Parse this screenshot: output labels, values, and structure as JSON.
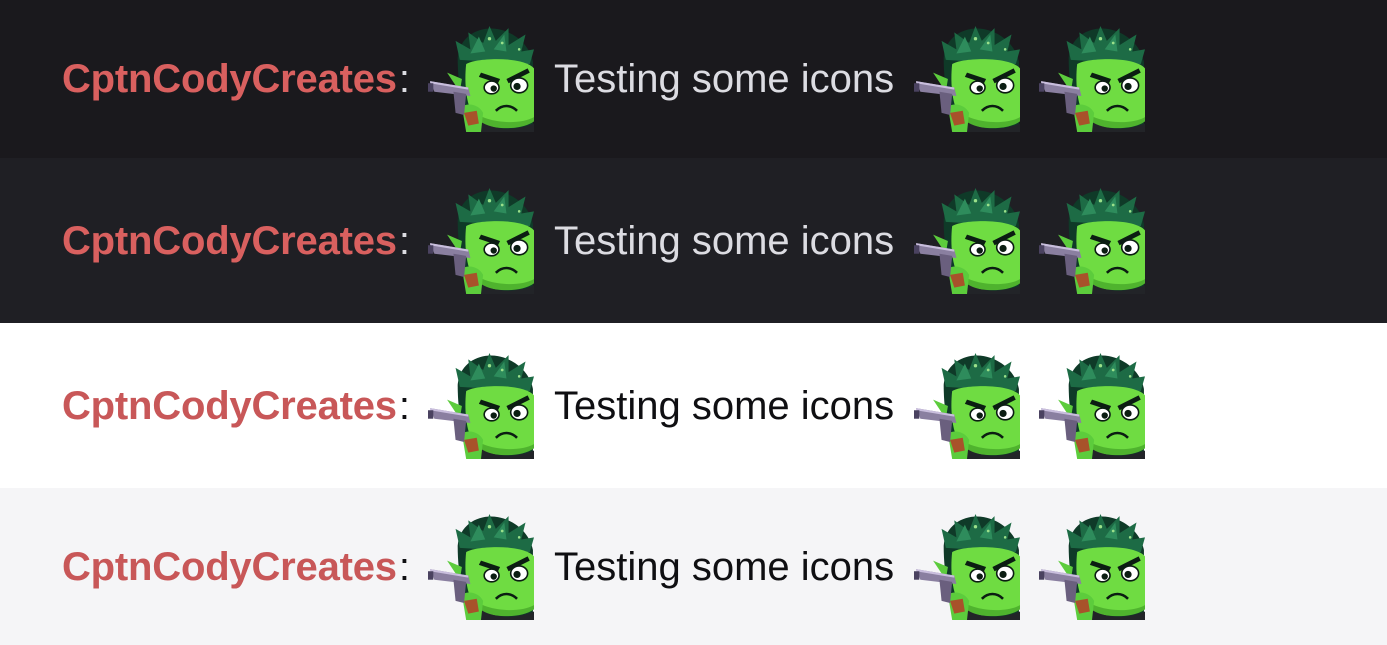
{
  "chat": {
    "messages": [
      {
        "theme": "dark",
        "background": "#1a191d",
        "username": "CptnCodyCreates",
        "username_color": "#d9605f",
        "separator": ":",
        "text": "Testing some icons",
        "text_color": "#dcdce2",
        "emotes": [
          "goblin-gunner-emote",
          "goblin-gunner-emote",
          "goblin-gunner-emote"
        ]
      },
      {
        "theme": "dark-alt",
        "background": "#1f1f24",
        "username": "CptnCodyCreates",
        "username_color": "#d9605f",
        "separator": ":",
        "text": "Testing some icons",
        "text_color": "#dcdce2",
        "emotes": [
          "goblin-gunner-emote",
          "goblin-gunner-emote",
          "goblin-gunner-emote"
        ]
      },
      {
        "theme": "light",
        "background": "#ffffff",
        "username": "CptnCodyCreates",
        "username_color": "#c85758",
        "separator": ":",
        "text": "Testing some icons",
        "text_color": "#0f0f12",
        "emotes": [
          "goblin-gunner-emote",
          "goblin-gunner-emote",
          "goblin-gunner-emote"
        ]
      },
      {
        "theme": "light-alt",
        "background": "#f5f5f7",
        "username": "CptnCodyCreates",
        "username_color": "#c85758",
        "separator": ":",
        "text": "Testing some icons",
        "text_color": "#0f0f12",
        "emotes": [
          "goblin-gunner-emote",
          "goblin-gunner-emote",
          "goblin-gunner-emote"
        ]
      }
    ]
  }
}
